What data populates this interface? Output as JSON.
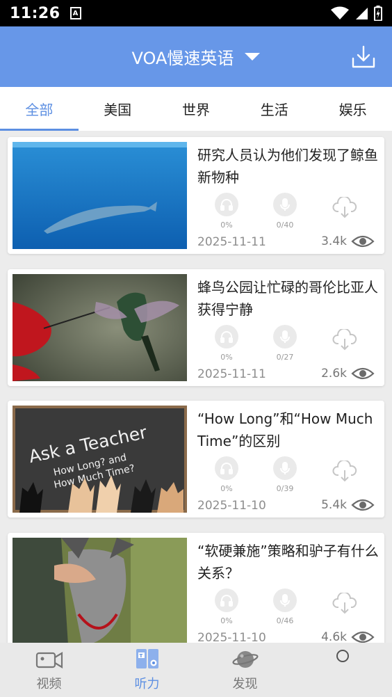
{
  "status_bar": {
    "time": "11:26",
    "notification_glyph": "A"
  },
  "header": {
    "title": "VOA慢速英语",
    "dropdown_icon": "caret-down-icon",
    "download_icon": "download-icon"
  },
  "tabs": [
    {
      "label": "全部",
      "active": true
    },
    {
      "label": "美国"
    },
    {
      "label": "世界"
    },
    {
      "label": "生活"
    },
    {
      "label": "娱乐"
    }
  ],
  "articles": [
    {
      "title": "研究人员认为他们发现了鲸鱼新物种",
      "listen_progress": "0%",
      "word_progress": "0/40",
      "date": "2025-11-11",
      "views": "3.4k"
    },
    {
      "title": "蜂鸟公园让忙碌的哥伦比亚人获得宁静",
      "listen_progress": "0%",
      "word_progress": "0/27",
      "date": "2025-11-11",
      "views": "2.6k"
    },
    {
      "title": "“How Long”和“How Much Time”的区别",
      "listen_progress": "0%",
      "word_progress": "0/39",
      "date": "2025-11-10",
      "views": "5.4k",
      "thumb_text": {
        "line1": "Ask a Teacher",
        "line2": "How Long? and",
        "line3": "How Much Time?"
      }
    },
    {
      "title": "“软硬兼施”策略和驴子有什么关系？",
      "listen_progress": "0%",
      "word_progress": "0/46",
      "date": "2025-11-10",
      "views": "4.6k"
    }
  ],
  "bottom_nav": [
    {
      "label": "视频",
      "icon": "video-camera-icon"
    },
    {
      "label": "听力",
      "icon": "book-icon",
      "active": true
    },
    {
      "label": "发现",
      "icon": "planet-icon"
    }
  ],
  "colors": {
    "primary": "#6797e8",
    "accent": "#5d8fe2",
    "background": "#ececec"
  }
}
